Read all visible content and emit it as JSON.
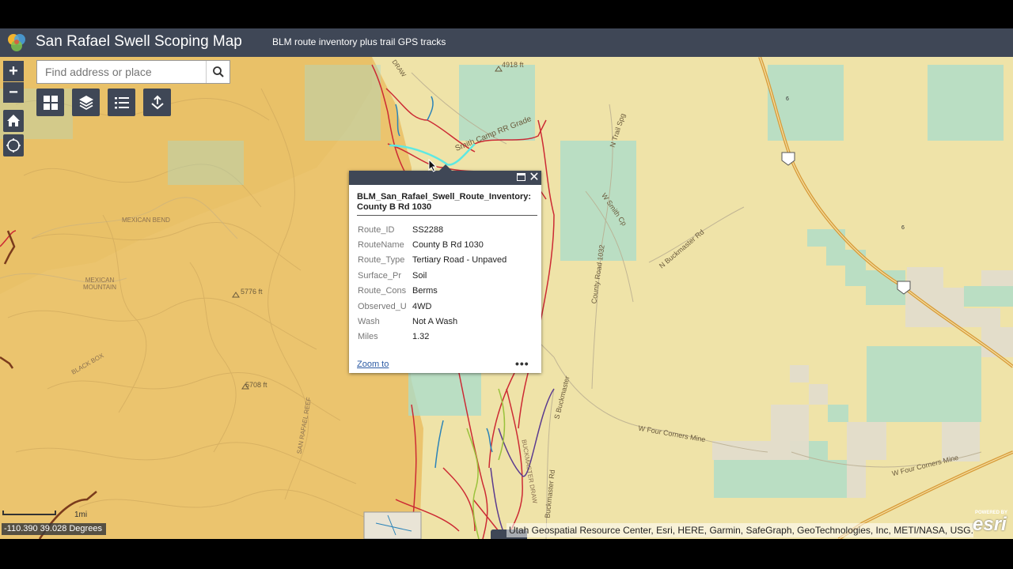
{
  "header": {
    "title": "San Rafael Swell Scoping Map",
    "subtitle": "BLM route inventory plus trail GPS tracks"
  },
  "search": {
    "placeholder": "Find address or place"
  },
  "zoom": {
    "in_label": "+",
    "out_label": "−"
  },
  "icons": {
    "logo": "app-logo-icon",
    "search": "search-icon",
    "home": "home-icon",
    "locate": "locate-icon",
    "basemap": "basemap-gallery-icon",
    "layers": "layers-icon",
    "legend": "legend-icon",
    "share": "share-icon",
    "close": "close-icon",
    "maximize": "maximize-icon"
  },
  "popup": {
    "title": "BLM_San_Rafael_Swell_Route_Inventory: County B Rd 1030",
    "close_label": "✕",
    "fields": [
      {
        "key": "Route_ID",
        "value": "SS2288"
      },
      {
        "key": "RouteName",
        "value": "County B Rd 1030"
      },
      {
        "key": "Route_Type",
        "value": "Tertiary Road - Unpaved"
      },
      {
        "key": "Surface_Pr",
        "value": "Soil"
      },
      {
        "key": "Route_Cons",
        "value": "Berms"
      },
      {
        "key": "Observed_U",
        "value": "4WD"
      },
      {
        "key": "Wash",
        "value": "Not A Wash"
      },
      {
        "key": "Miles",
        "value": "1.32"
      }
    ],
    "zoom_label": "Zoom to",
    "more_label": "•••"
  },
  "map_labels": {
    "elev_4918": "4918 ft",
    "smith_camp": "Smith Camp RR Grade",
    "n_trail_spg": "N Trail Spg",
    "w_smith_cp": "W Smith Cp",
    "county_road_1032": "County Road 1032",
    "n_buckmaster": "N Buckmaster Rd",
    "mexican_bend": "MEXICAN BEND",
    "mexican_mountain": "MEXICAN MOUNTAIN",
    "elev_5776": "5776 ft",
    "elev_5708": "5708 ft",
    "black_box": "BLACK BOX",
    "san_rafael_reef": "SAN RAFAEL REEF",
    "s_buckmaster": "S Buckmaster",
    "buckmaster_draw": "BUCKMASTER DRAW",
    "buckmaster_rd": "Buckmaster Rd",
    "w_four_corners_1": "W Four Corners Mine",
    "w_four_corners_2": "W Four Corners Mine",
    "hwy_6a": "6",
    "hwy_6b": "6",
    "draw": "DRAW"
  },
  "scale": {
    "label": "1mi"
  },
  "coordinates": "-110.390 39.028 Degrees",
  "attribution": "Utah Geospatial Resource Center, Esri, HERE, Garmin, SafeGraph, GeoTechnologies, Inc, METI/NASA, USG...",
  "esri": {
    "powered_by": "POWERED BY",
    "brand": "esri"
  },
  "colors": {
    "header": "#3f4756",
    "terrain_dark": "#ebc46e",
    "terrain_light": "#efe3a8",
    "blm_land": "#a9dccd",
    "routes": "#cc2a34",
    "trails_purple": "#5b3b8f",
    "trails_green": "#9ac23c",
    "highway": "#d89d3c"
  }
}
